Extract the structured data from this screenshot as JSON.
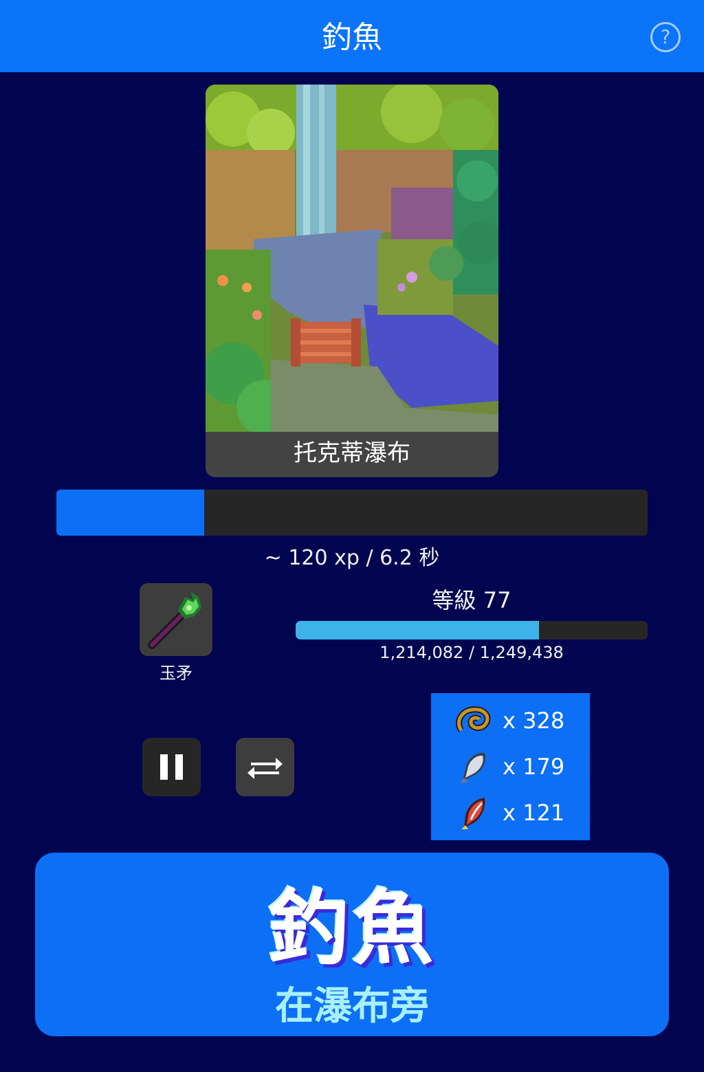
{
  "header": {
    "title": "釣魚",
    "help_icon": "?"
  },
  "location": {
    "name": "托克蒂瀑布"
  },
  "action": {
    "progress": 0.25,
    "rate_text": "~ 120 xp / 6.2 秒"
  },
  "tool": {
    "name": "玉矛"
  },
  "level": {
    "label": "等級 77",
    "xp_text": "1,214,082 / 1,249,438",
    "xp_current": 1214082,
    "xp_next": 1249438
  },
  "loot": [
    {
      "icon": "eel-icon",
      "count": "x 328"
    },
    {
      "icon": "silver-fish-icon",
      "count": "x 179"
    },
    {
      "icon": "red-fish-icon",
      "count": "x 121"
    }
  ],
  "main_button": {
    "title": "釣魚",
    "subtitle": "在瀑布旁"
  },
  "colors": {
    "background": "#010550",
    "accent": "#0c6ff5",
    "xp_bar": "#3cb4ea"
  }
}
